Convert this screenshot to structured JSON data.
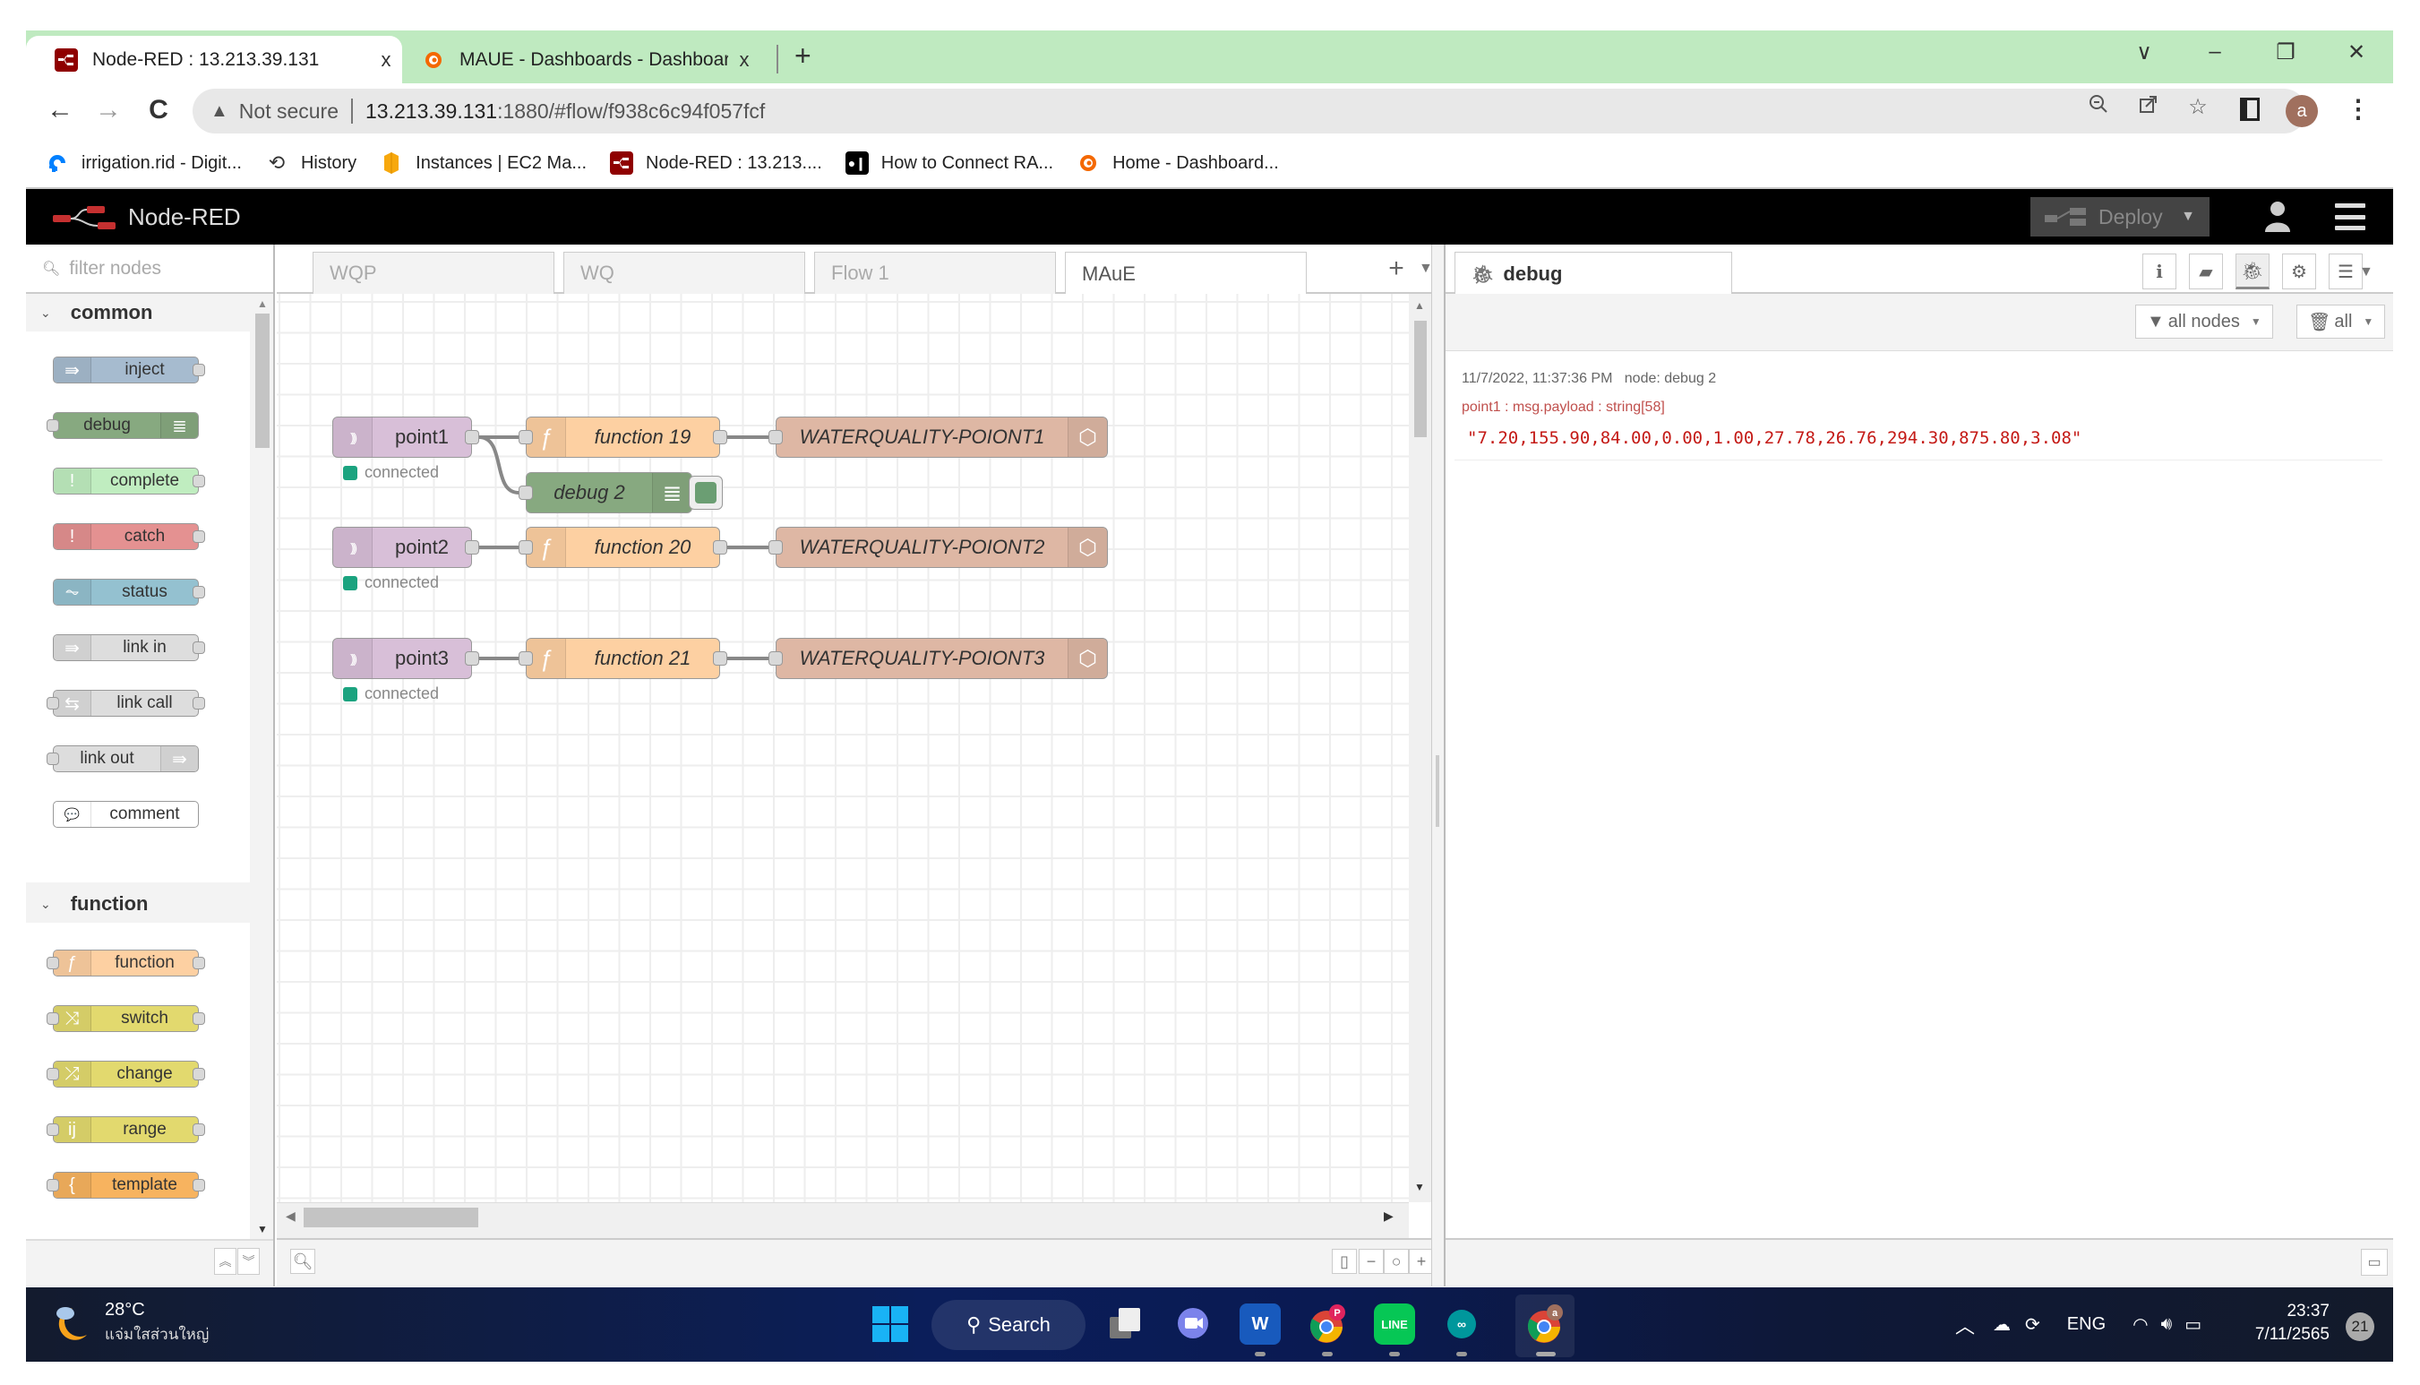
{
  "browser": {
    "tabs": [
      {
        "title": "Node-RED : 13.213.39.131",
        "icon": "node-red-icon",
        "active": true,
        "close": "x"
      },
      {
        "title": "MAUE - Dashboards - Dashboard",
        "icon": "grafana-icon",
        "active": false,
        "close": "x"
      }
    ],
    "new_tab": "+",
    "window_controls": {
      "tab_search": "∨",
      "minimize": "–",
      "restore": "❐",
      "close": "✕"
    },
    "nav": {
      "back": "←",
      "forward": "→",
      "reload": "C"
    },
    "address": {
      "security_label": "Not secure",
      "warning_icon": "▲",
      "host": "13.213.39.131",
      "path": ":1880/#flow/f938c6c94f057fcf"
    },
    "profile_initial": "a",
    "bookmarks": [
      {
        "label": "irrigation.rid - Digit...",
        "icon": "digitalocean-icon"
      },
      {
        "label": "History",
        "icon": "history-icon"
      },
      {
        "label": "Instances | EC2 Ma...",
        "icon": "aws-icon"
      },
      {
        "label": "Node-RED : 13.213....",
        "icon": "node-red-icon"
      },
      {
        "label": "How to Connect RA...",
        "icon": "medium-icon"
      },
      {
        "label": "Home - Dashboard...",
        "icon": "grafana-icon"
      }
    ]
  },
  "nodered": {
    "brand": "Node-RED",
    "deploy_label": "Deploy",
    "palette": {
      "filter_placeholder": "filter nodes",
      "categories": [
        {
          "name": "common",
          "nodes": [
            {
              "label": "inject",
              "color": "#a6bbcf",
              "icon": "⇛",
              "in": false,
              "out": true,
              "icon_right": false
            },
            {
              "label": "debug",
              "color": "#87a980",
              "icon": "≣",
              "in": true,
              "out": false,
              "icon_right": true
            },
            {
              "label": "complete",
              "color": "#c0edc0",
              "icon": "!",
              "in": false,
              "out": true,
              "icon_right": false
            },
            {
              "label": "catch",
              "color": "#e49191",
              "icon": "!",
              "in": false,
              "out": true,
              "icon_right": false
            },
            {
              "label": "status",
              "color": "#94c1d0",
              "icon": "⏦",
              "in": false,
              "out": true,
              "icon_right": false
            },
            {
              "label": "link in",
              "color": "#dddddd",
              "icon": "⇛",
              "in": false,
              "out": true,
              "icon_right": false
            },
            {
              "label": "link call",
              "color": "#dddddd",
              "icon": "⇆",
              "in": true,
              "out": true,
              "icon_right": false
            },
            {
              "label": "link out",
              "color": "#dddddd",
              "icon": "⇛",
              "in": true,
              "out": false,
              "icon_right": true
            },
            {
              "label": "comment",
              "color": "#ffffff",
              "icon": "💬",
              "in": false,
              "out": false,
              "icon_right": false
            }
          ]
        },
        {
          "name": "function",
          "nodes": [
            {
              "label": "function",
              "color": "#fdd0a2",
              "icon": "ƒ",
              "in": true,
              "out": true,
              "icon_right": false
            },
            {
              "label": "switch",
              "color": "#e2d96e",
              "icon": "⤨",
              "in": true,
              "out": true,
              "icon_right": false
            },
            {
              "label": "change",
              "color": "#e2d96e",
              "icon": "⤮",
              "in": true,
              "out": true,
              "icon_right": false
            },
            {
              "label": "range",
              "color": "#e2d96e",
              "icon": "ij",
              "in": true,
              "out": true,
              "icon_right": false
            },
            {
              "label": "template",
              "color": "#f7b35f",
              "icon": "{",
              "in": true,
              "out": true,
              "icon_right": false
            }
          ]
        }
      ]
    },
    "workspace": {
      "tabs": [
        {
          "label": "WQP",
          "active": false
        },
        {
          "label": "WQ",
          "active": false
        },
        {
          "label": "Flow 1",
          "active": false
        },
        {
          "label": "MAuE",
          "active": true
        }
      ],
      "add_label": "+",
      "flows": [
        {
          "id": "p1",
          "label": "point1",
          "type": "mqtt-in",
          "color": "#d8bfd8",
          "status": "connected"
        },
        {
          "id": "f19",
          "label": "function 19",
          "type": "function",
          "color": "#fdd0a2"
        },
        {
          "id": "w1",
          "label": "WATERQUALITY-POIONT1",
          "type": "influx-out",
          "color": "#deb7a4"
        },
        {
          "id": "d2",
          "label": "debug 2",
          "type": "debug",
          "color": "#87a980"
        },
        {
          "id": "p2",
          "label": "point2",
          "type": "mqtt-in",
          "color": "#d8bfd8",
          "status": "connected"
        },
        {
          "id": "f20",
          "label": "function 20",
          "type": "function",
          "color": "#fdd0a2"
        },
        {
          "id": "w2",
          "label": "WATERQUALITY-POIONT2",
          "type": "influx-out",
          "color": "#deb7a4"
        },
        {
          "id": "p3",
          "label": "point3",
          "type": "mqtt-in",
          "color": "#d8bfd8",
          "status": "connected"
        },
        {
          "id": "f21",
          "label": "function 21",
          "type": "function",
          "color": "#fdd0a2"
        },
        {
          "id": "w3",
          "label": "WATERQUALITY-POIONT3",
          "type": "influx-out",
          "color": "#deb7a4"
        }
      ],
      "wires": [
        [
          "p1",
          "f19"
        ],
        [
          "p1",
          "d2"
        ],
        [
          "f19",
          "w1"
        ],
        [
          "p2",
          "f20"
        ],
        [
          "f20",
          "w2"
        ],
        [
          "p3",
          "f21"
        ],
        [
          "f21",
          "w3"
        ]
      ],
      "status_color": "#1ba37f"
    },
    "sidebar": {
      "active_tab": "debug",
      "filter_label": "all nodes",
      "clear_label": "all",
      "message": {
        "timestamp": "11/7/2022, 11:37:36 PM",
        "node": "node: debug 2",
        "topic": "point1 : msg.payload : string[58]",
        "value": "\"7.20,155.90,84.00,0.00,1.00,27.78,26.76,294.30,875.80,3.08\""
      }
    }
  },
  "taskbar": {
    "weather_temp": "28°C",
    "weather_desc": "แจ่มใสส่วนใหญ่",
    "search_label": "Search",
    "language": "ENG",
    "time": "23:37",
    "date": "7/11/2565",
    "notification_count": "21",
    "chrome_badge": "P",
    "chrome_profile_badge": "a"
  }
}
